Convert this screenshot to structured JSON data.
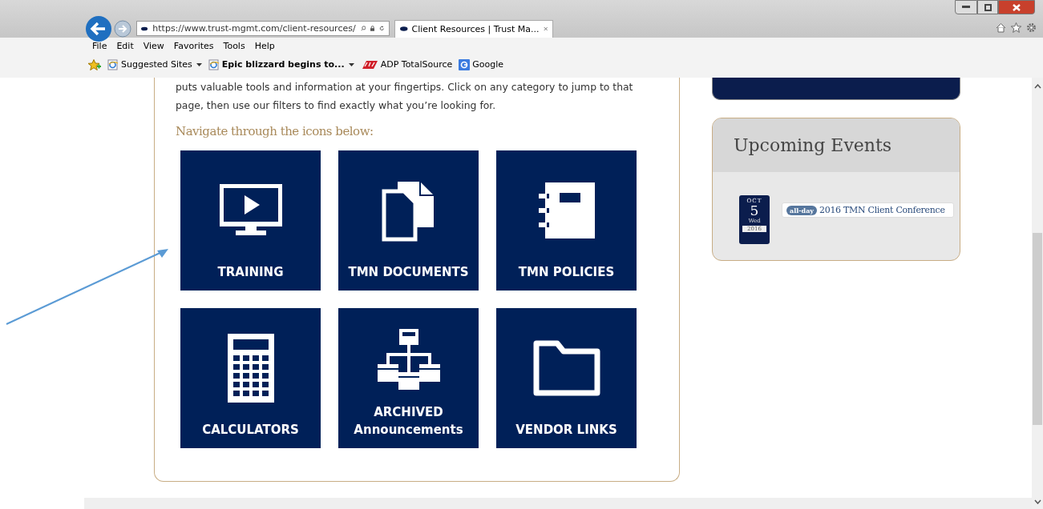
{
  "browser": {
    "address": "https://www.trust-mgmt.com/client-resources/",
    "tab": {
      "title": "Client Resources | Trust Ma...",
      "selected": true
    },
    "menu": [
      "File",
      "Edit",
      "View",
      "Favorites",
      "Tools",
      "Help"
    ],
    "favorites": [
      {
        "kind": "ie",
        "label": "Suggested Sites",
        "bold": false,
        "dropdown": true
      },
      {
        "kind": "ie",
        "label": "Epic blizzard begins to...",
        "bold": true,
        "dropdown": true
      },
      {
        "kind": "adp",
        "label": "ADP TotalSource",
        "bold": false,
        "dropdown": false
      },
      {
        "kind": "google",
        "label": "Google",
        "bold": false,
        "dropdown": false
      }
    ]
  },
  "content": {
    "intro": "puts valuable tools and information at your fingertips. Click on any category to jump to that page, then use our filters to find exactly what you’re looking for.",
    "heading": "Navigate through the icons below:",
    "tiles": [
      {
        "kind": "monitor",
        "label": "TRAINING"
      },
      {
        "kind": "documents",
        "label": "TMN DOCUMENTS"
      },
      {
        "kind": "notebook",
        "label": "TMN POLICIES"
      },
      {
        "kind": "calculator",
        "label": "CALCULATORS"
      },
      {
        "kind": "hierarchy",
        "label": "ARCHIVED\nAnnouncements"
      },
      {
        "kind": "folder",
        "label": "VENDOR LINKS"
      }
    ]
  },
  "sidebar": {
    "events": {
      "title": "Upcoming Events",
      "items": [
        {
          "month": "OCT",
          "day": "5",
          "weekday": "Wed",
          "year": "2016",
          "tag": "all-day",
          "title": "2016 TMN Client Conference"
        }
      ]
    }
  }
}
